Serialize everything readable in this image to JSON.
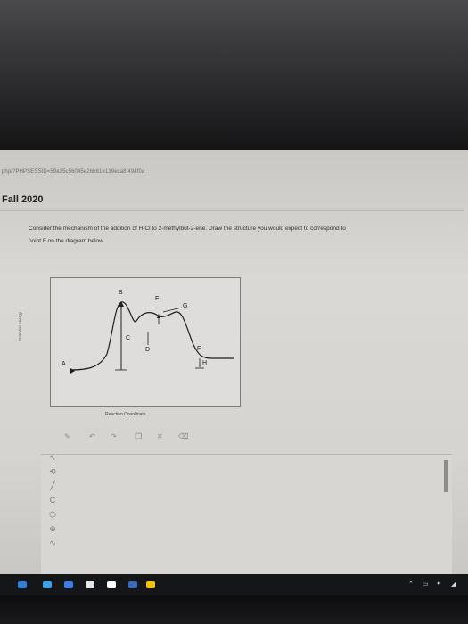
{
  "browser": {
    "url": "php/?PHPSESSID=59a35c56045e26b61e139eca8f494f0a"
  },
  "page": {
    "course_title": "Fall 2020",
    "question_line1": "Consider the mechanism of the addition of H-Cl to 2-methylbut-2-ene.  Draw the structure you would expect to correspond to",
    "question_line2": "point F on the diagram below."
  },
  "diagram": {
    "y_axis_label": "Potential Energy",
    "x_axis_label": "Reaction Coordinate",
    "points": {
      "A": "A",
      "B": "B",
      "C": "C",
      "D": "D",
      "E": "E",
      "F": "F",
      "G": "G",
      "H": "H"
    }
  },
  "toolbar": {
    "icons": [
      "pen-icon",
      "undo-icon",
      "redo-icon",
      "copy-icon",
      "delete-icon",
      "clear-icon"
    ],
    "glyphs": [
      "✎",
      "↶",
      "↷",
      "❐",
      "✕",
      "⌫"
    ]
  },
  "side_tools": {
    "icons": [
      "select-icon",
      "lasso-icon",
      "bond-icon",
      "carbon-chain-icon",
      "ring-icon",
      "atom-icon",
      "charge-icon"
    ],
    "glyphs": [
      "↖",
      "⟲",
      "╱",
      "C",
      "⬡",
      "⊕",
      "∿"
    ]
  },
  "taskbar": {
    "colors": [
      "#2d7fd8",
      "#3aa0f0",
      "#3a7fe0",
      "#e6e6e6",
      "#ffffff",
      "#3c68b8",
      "#f2c400"
    ]
  },
  "colors": {
    "bezel": "#2a2a2c",
    "screen_bg": "#d5d4d0",
    "curve": "#1f1f1f"
  }
}
